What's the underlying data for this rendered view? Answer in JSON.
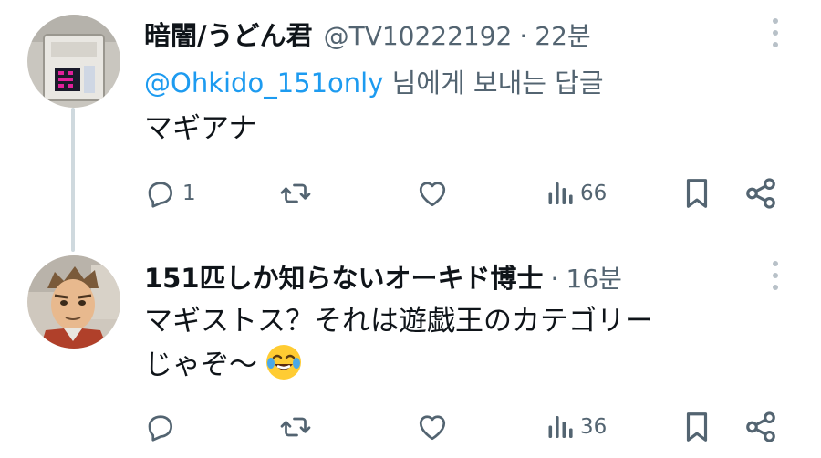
{
  "tweets": [
    {
      "display_name": "暗闇/うどん君",
      "handle": "@TV10222192",
      "separator": "·",
      "time": "22분",
      "reply_to_handle": "@Ohkido_151only",
      "reply_to_suffix": " 님에게 보내는 답글",
      "text_lines": [
        "マギアナ"
      ],
      "reply_count": "1",
      "retweet_count": "",
      "like_count": "",
      "view_count": "66"
    },
    {
      "display_name": "151匹しか知らないオーキド博士",
      "handle": "",
      "separator": "·",
      "time": "16분",
      "text_lines": [
        "マギストス？それは遊戯王のカテゴリー",
        "じゃぞ〜"
      ],
      "emoji": "face-with-tears-of-joy",
      "reply_count": "",
      "retweet_count": "",
      "like_count": "",
      "view_count": "36"
    }
  ],
  "colors": {
    "text": "#0f1419",
    "secondary": "#536471",
    "link": "#1d9bf0",
    "thread_line": "#cfd9de"
  },
  "icons": [
    "reply-icon",
    "retweet-icon",
    "like-icon",
    "views-icon",
    "bookmark-icon",
    "share-icon",
    "more-icon"
  ]
}
